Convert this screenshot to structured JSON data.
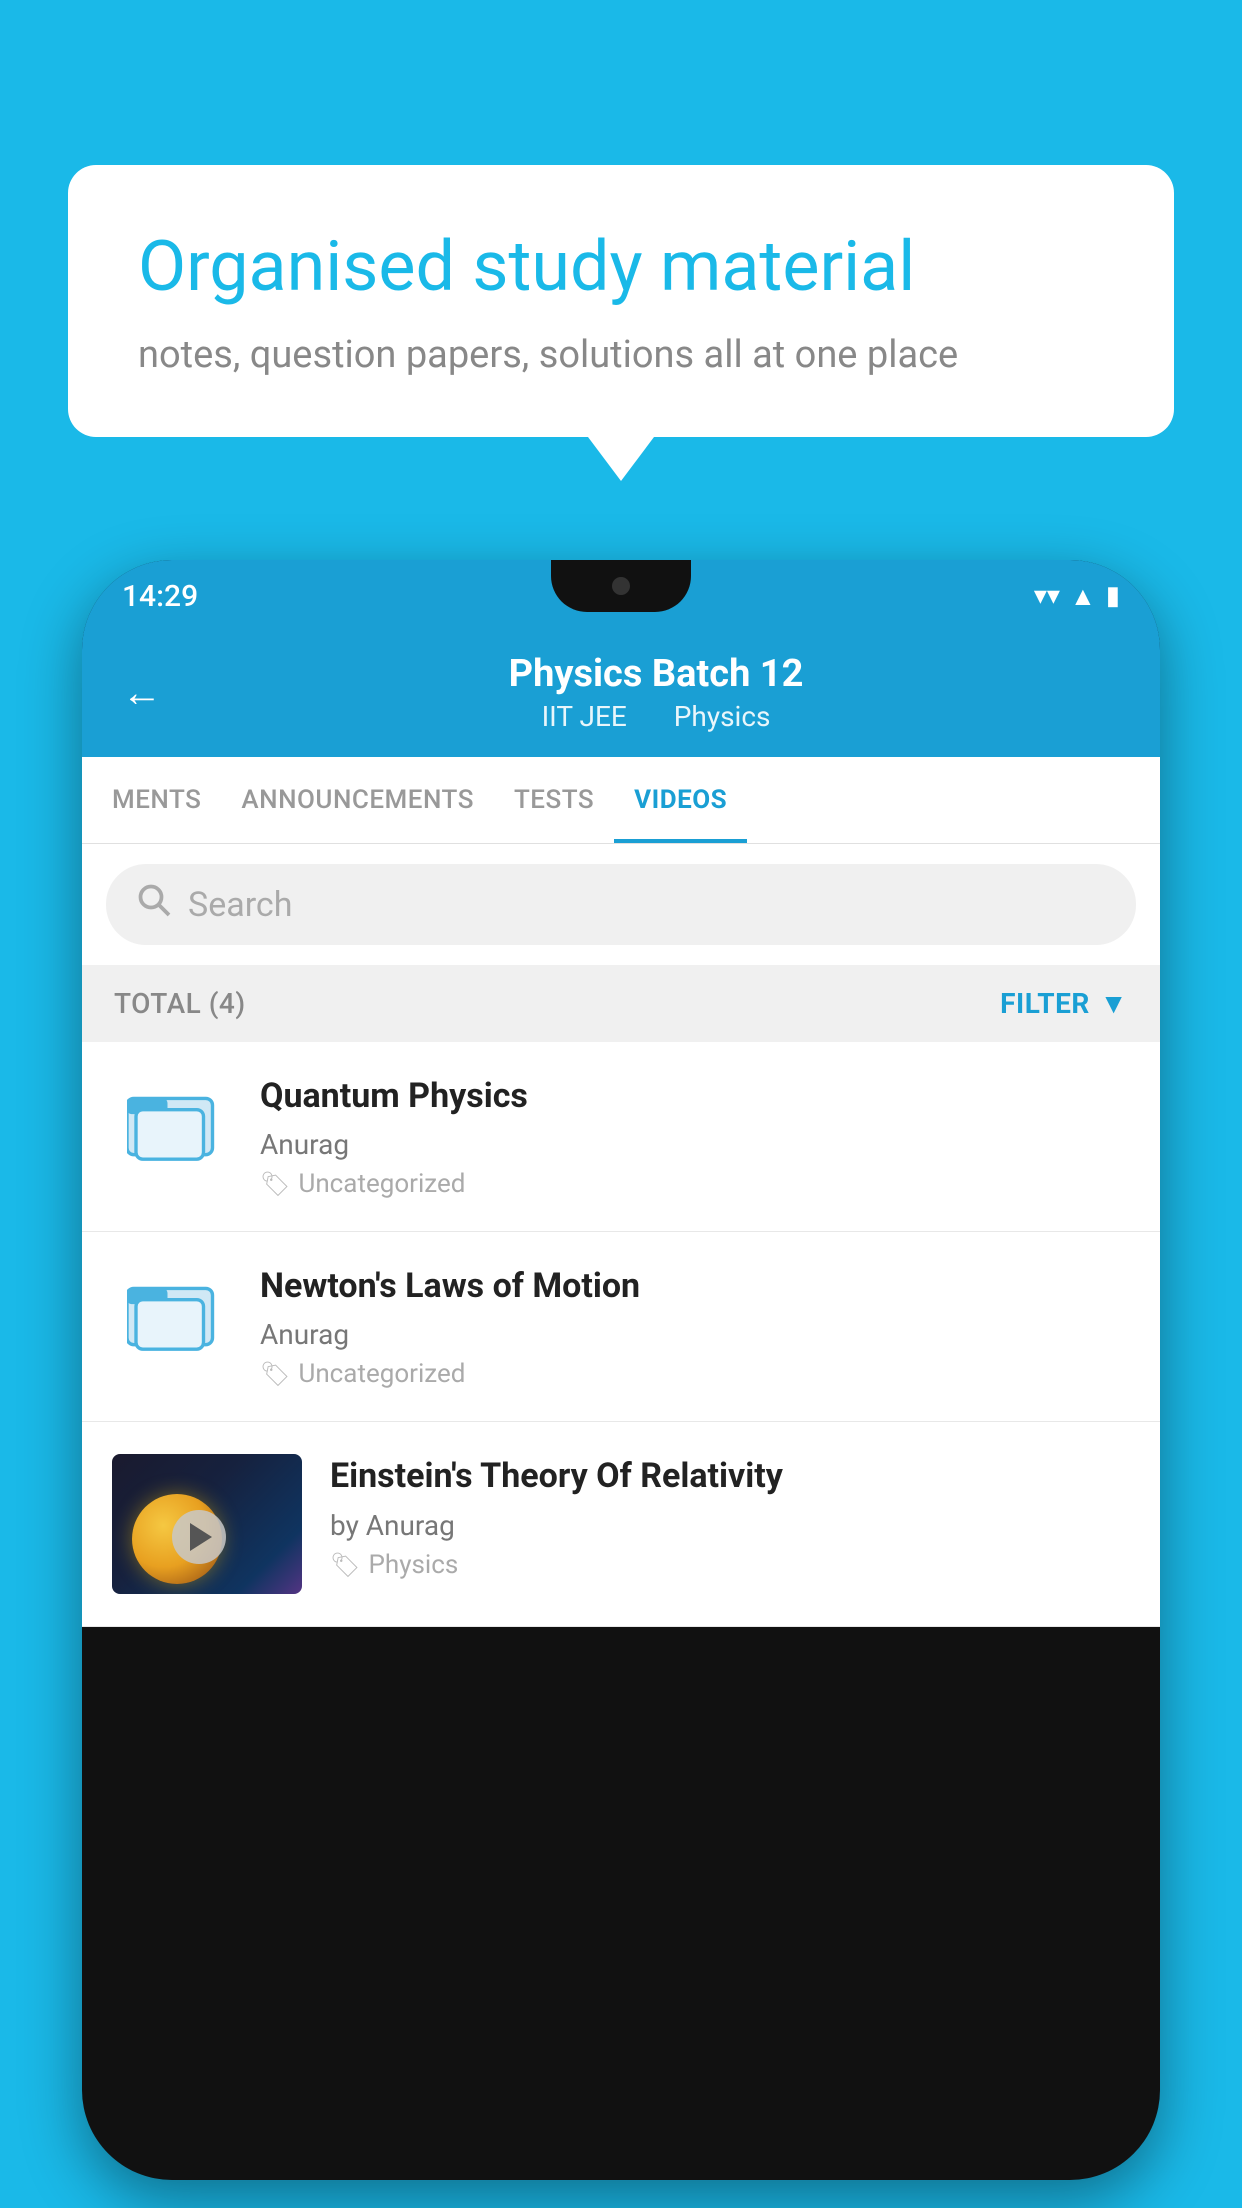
{
  "background_color": "#1ab9e8",
  "speech_bubble": {
    "heading": "Organised study material",
    "subtext": "notes, question papers, solutions all at one place"
  },
  "phone": {
    "status_bar": {
      "time": "14:29",
      "icons": [
        "wifi",
        "signal",
        "battery"
      ]
    },
    "header": {
      "title": "Physics Batch 12",
      "subtitle_parts": [
        "IIT JEE",
        "Physics"
      ],
      "back_label": "←"
    },
    "tabs": [
      {
        "label": "MENTS",
        "active": false
      },
      {
        "label": "ANNOUNCEMENTS",
        "active": false
      },
      {
        "label": "TESTS",
        "active": false
      },
      {
        "label": "VIDEOS",
        "active": true
      }
    ],
    "search": {
      "placeholder": "Search"
    },
    "filter_bar": {
      "total_label": "TOTAL (4)",
      "filter_label": "FILTER"
    },
    "videos": [
      {
        "id": 1,
        "title": "Quantum Physics",
        "author": "Anurag",
        "tag": "Uncategorized",
        "has_thumbnail": false
      },
      {
        "id": 2,
        "title": "Newton's Laws of Motion",
        "author": "Anurag",
        "tag": "Uncategorized",
        "has_thumbnail": false
      },
      {
        "id": 3,
        "title": "Einstein's Theory Of Relativity",
        "author": "by Anurag",
        "tag": "Physics",
        "has_thumbnail": true
      }
    ]
  }
}
